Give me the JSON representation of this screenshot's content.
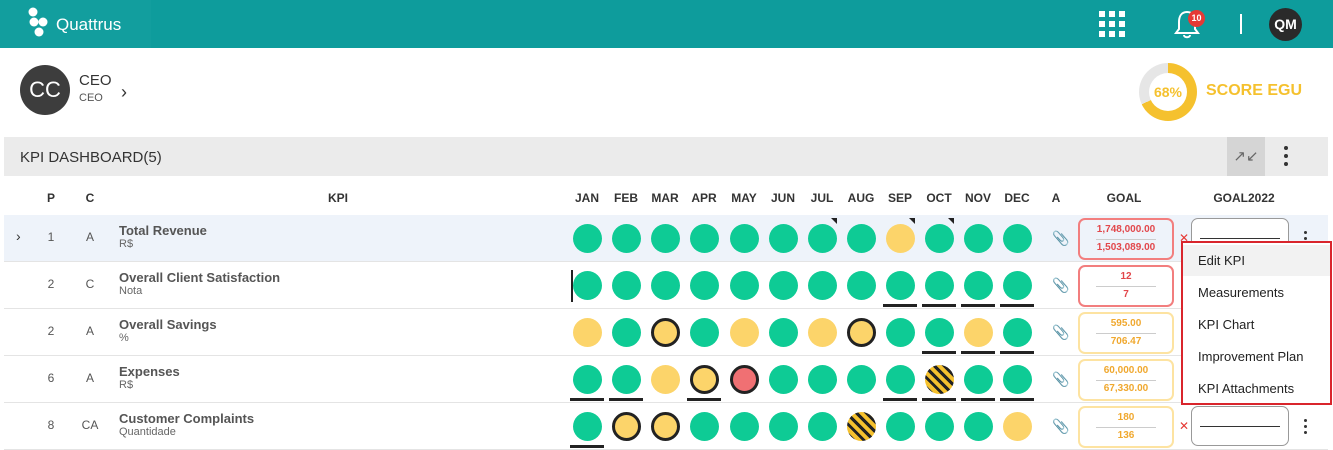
{
  "app": {
    "name": "Quattrus",
    "notification_count": "10",
    "user_initials": "QM"
  },
  "profile": {
    "initials": "CC",
    "name": "CEO",
    "subtitle": "CEO"
  },
  "score": {
    "percent": "68%",
    "percent_value": 68,
    "label": "SCORE EGU"
  },
  "dashboard": {
    "title": "KPI DASHBOARD(5)"
  },
  "columns": {
    "p": "P",
    "c": "C",
    "kpi": "KPI",
    "months": [
      "JAN",
      "FEB",
      "MAR",
      "APR",
      "MAY",
      "JUN",
      "JUL",
      "AUG",
      "SEP",
      "OCT",
      "NOV",
      "DEC"
    ],
    "a": "A",
    "goal": "GOAL",
    "goal2022": "GOAL2022"
  },
  "rows": [
    {
      "p": "1",
      "c": "A",
      "name": "Total Revenue",
      "unit": "R$",
      "months": [
        {
          "status": "green"
        },
        {
          "status": "green"
        },
        {
          "status": "green"
        },
        {
          "status": "green"
        },
        {
          "status": "green"
        },
        {
          "status": "green"
        },
        {
          "status": "green",
          "flag": true
        },
        {
          "status": "green"
        },
        {
          "status": "yellow",
          "flag": true
        },
        {
          "status": "green",
          "flag": true
        },
        {
          "status": "green"
        },
        {
          "status": "green"
        }
      ],
      "attachment": "faded",
      "goal_status": "red",
      "goal_value": "1,748,000.00",
      "goal_actual": "1,503,089.00"
    },
    {
      "p": "2",
      "c": "C",
      "name": "Overall Client Satisfaction",
      "unit": "Nota",
      "months": [
        {
          "status": "green"
        },
        {
          "status": "green"
        },
        {
          "status": "green"
        },
        {
          "status": "green"
        },
        {
          "status": "green"
        },
        {
          "status": "green"
        },
        {
          "status": "green"
        },
        {
          "status": "green"
        },
        {
          "status": "green",
          "underline": true
        },
        {
          "status": "green",
          "underline": true
        },
        {
          "status": "green",
          "underline": true
        },
        {
          "status": "green",
          "underline": true
        }
      ],
      "attachment": "solid",
      "goal_status": "red",
      "goal_value": "12",
      "goal_actual": "7"
    },
    {
      "p": "2",
      "c": "A",
      "name": "Overall Savings",
      "unit": "%",
      "months": [
        {
          "status": "yellow"
        },
        {
          "status": "green"
        },
        {
          "status": "yellow",
          "ring": true
        },
        {
          "status": "green"
        },
        {
          "status": "yellow"
        },
        {
          "status": "green"
        },
        {
          "status": "yellow"
        },
        {
          "status": "yellow",
          "ring": true
        },
        {
          "status": "green"
        },
        {
          "status": "green",
          "underline": true
        },
        {
          "status": "yellow",
          "underline": true
        },
        {
          "status": "green",
          "underline": true
        }
      ],
      "attachment": "faded",
      "goal_status": "yellow",
      "goal_value": "595.00",
      "goal_actual": "706.47"
    },
    {
      "p": "6",
      "c": "A",
      "name": "Expenses",
      "unit": "R$",
      "months": [
        {
          "status": "green",
          "underline": true
        },
        {
          "status": "green",
          "underline": true
        },
        {
          "status": "yellow"
        },
        {
          "status": "yellow",
          "ring": true,
          "underline": true
        },
        {
          "status": "red",
          "ring": true
        },
        {
          "status": "green"
        },
        {
          "status": "green"
        },
        {
          "status": "green"
        },
        {
          "status": "green",
          "underline": true
        },
        {
          "status": "hatch",
          "underline": true
        },
        {
          "status": "green",
          "underline": true
        },
        {
          "status": "green",
          "underline": true
        }
      ],
      "attachment": "faded",
      "goal_status": "yellow",
      "goal_value": "60,000.00",
      "goal_actual": "67,330.00"
    },
    {
      "p": "8",
      "c": "CA",
      "name": "Customer Complaints",
      "unit": "Quantidade",
      "months": [
        {
          "status": "green",
          "underline": true
        },
        {
          "status": "yellow",
          "ring": true
        },
        {
          "status": "yellow",
          "ring": true
        },
        {
          "status": "green"
        },
        {
          "status": "green"
        },
        {
          "status": "green"
        },
        {
          "status": "green"
        },
        {
          "status": "hatch"
        },
        {
          "status": "green"
        },
        {
          "status": "green"
        },
        {
          "status": "green"
        },
        {
          "status": "yellow"
        }
      ],
      "attachment": "faded",
      "goal_status": "yellow",
      "goal_value": "180",
      "goal_actual": "136"
    }
  ],
  "context_menu": {
    "items": [
      {
        "label": "Edit KPI",
        "hover": true
      },
      {
        "label": "Measurements"
      },
      {
        "label": "KPI Chart"
      },
      {
        "label": "Improvement Plan"
      },
      {
        "label": "KPI Attachments"
      }
    ]
  },
  "colors": {
    "brand": "#0e9c9c",
    "green": "#0ecb95",
    "yellow": "#fcd46a",
    "red": "#f07073",
    "score": "#f5c12e",
    "menu_border": "#d9252c"
  }
}
